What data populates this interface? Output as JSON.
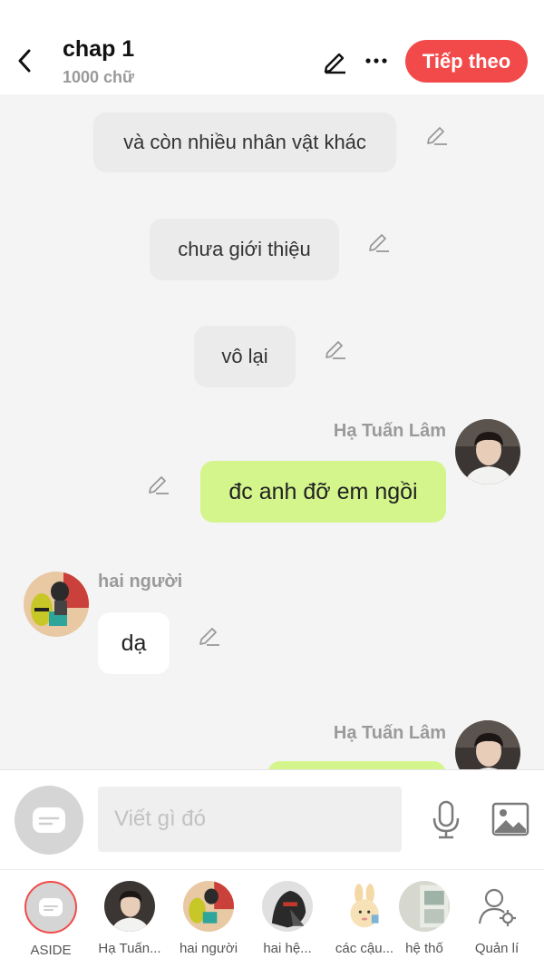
{
  "header": {
    "title": "chap 1",
    "subtitle": "1000 chữ",
    "next_label": "Tiếp theo"
  },
  "messages": [
    {
      "type": "aside",
      "text": "và còn nhiều nhân vật khác"
    },
    {
      "type": "aside",
      "text": "chưa giới thiệu"
    },
    {
      "type": "aside",
      "text": "vô lại"
    },
    {
      "type": "right",
      "sender": "Hạ Tuấn Lâm",
      "text": "đc anh đỡ em ngồi"
    },
    {
      "type": "left",
      "sender": "hai người",
      "text": "dạ"
    },
    {
      "type": "right",
      "sender": "Hạ Tuấn Lâm",
      "text": ""
    }
  ],
  "composer": {
    "placeholder": "Viết gì đó"
  },
  "characters": [
    {
      "label": "ASIDE"
    },
    {
      "label": "Hạ Tuấn..."
    },
    {
      "label": "hai người"
    },
    {
      "label": "hai hệ..."
    },
    {
      "label": "các cậu..."
    },
    {
      "label": "hệ thố"
    },
    {
      "label": "Quản lí"
    }
  ],
  "colors": {
    "accent": "#f24a4a",
    "right_bubble": "#d4f58c",
    "aside_bubble": "#ebebeb",
    "background": "#f4f4f4"
  }
}
